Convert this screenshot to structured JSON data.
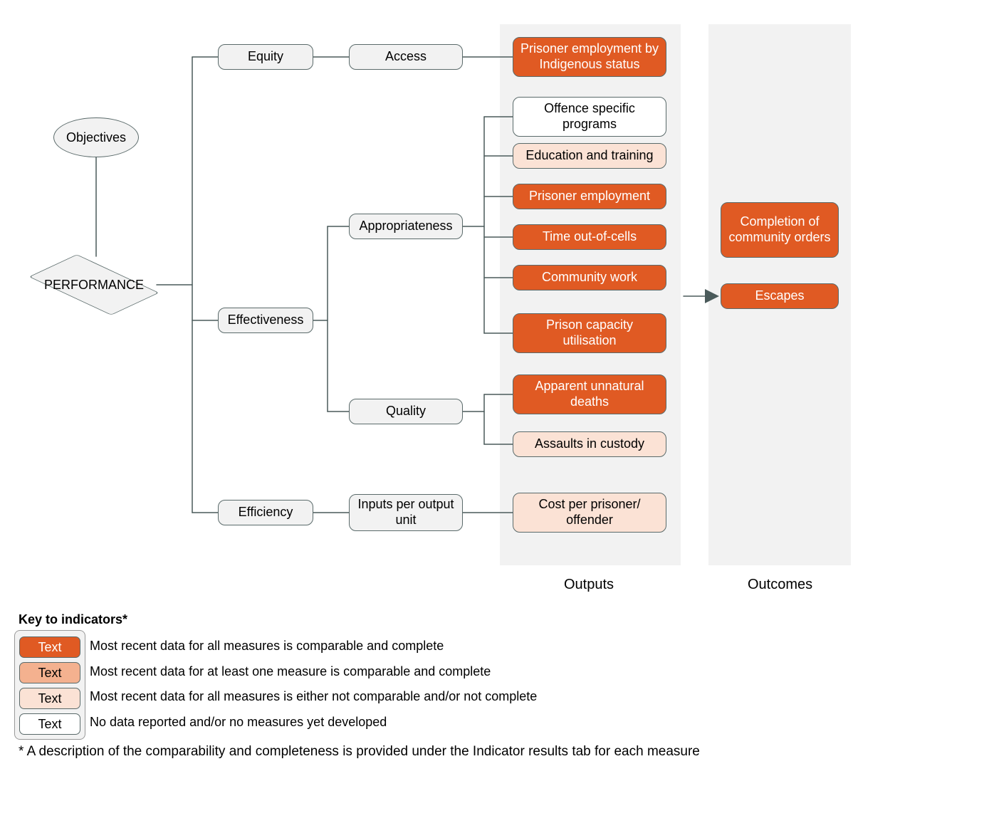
{
  "nodes": {
    "objectives": "Objectives",
    "performance": "PERFORMANCE",
    "equity": "Equity",
    "effectiveness": "Effectiveness",
    "efficiency": "Efficiency",
    "access": "Access",
    "appropriateness": "Appropriateness",
    "quality": "Quality",
    "inputs": "Inputs per output unit",
    "prisoner_employment_indig": "Prisoner employment by Indigenous status",
    "offence_programs": "Offence specific programs",
    "education_training": "Education and training",
    "prisoner_employment": "Prisoner employment",
    "time_out": "Time out-of-cells",
    "community_work": "Community work",
    "prison_capacity": "Prison capacity utilisation",
    "unnatural_deaths": "Apparent unnatural deaths",
    "assaults": "Assaults in custody",
    "cost_per": "Cost per prisoner/ offender",
    "completion": "Completion of community orders",
    "escapes": "Escapes"
  },
  "sections": {
    "outputs": "Outputs",
    "outcomes": "Outcomes"
  },
  "legend": {
    "title": "Key to indicators*",
    "chip_text": "Text",
    "rows": {
      "r1": "Most recent data for all measures is comparable and complete",
      "r2": "Most recent data for at least one measure is comparable and complete",
      "r3": "Most recent data for all measures is either not comparable and/or not complete",
      "r4": "No data reported and/or no measures yet developed"
    },
    "footnote": "* A description of the comparability and completeness is provided under the Indicator results tab for each measure"
  }
}
